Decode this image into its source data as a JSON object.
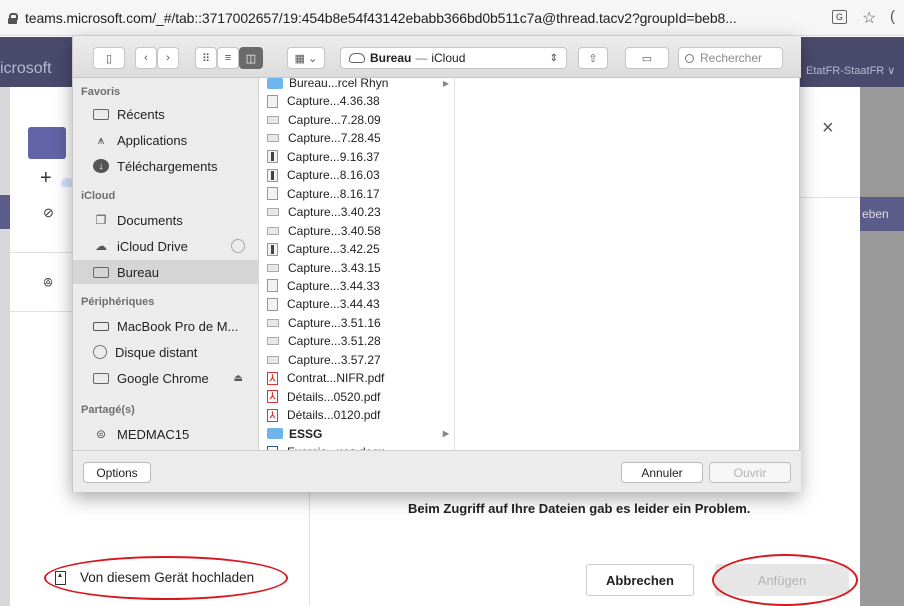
{
  "browser": {
    "url": "teams.microsoft.com/_#/tab::3717002657/19:454b8e54f43142ebabb366bd0b511c7a@thread.tacv2?groupId=beb8..."
  },
  "teams": {
    "brand": "icrosoft",
    "org": "EtatFR-StaatFR ∨",
    "right_sub": "eben"
  },
  "modal": {
    "error_message": "Beim Zugriff auf Ihre Dateien gab es leider ein Problem.",
    "upload_label": "Von diesem Gerät hochladen",
    "cancel_label": "Abbrechen",
    "attach_label": "Anfügen",
    "close_glyph": "×",
    "annotation_color": "#d7191f"
  },
  "picker": {
    "location": {
      "name": "Bureau",
      "separator": "—",
      "service": "iCloud"
    },
    "search_placeholder": "Rechercher",
    "sections": {
      "favorites": "Favoris",
      "icloud": "iCloud",
      "devices": "Périphériques",
      "shared": "Partagé(s)"
    },
    "favorites": [
      {
        "label": "Récents",
        "icon": "recents-icon"
      },
      {
        "label": "Applications",
        "icon": "applications-icon"
      },
      {
        "label": "Téléchargements",
        "icon": "downloads-icon"
      }
    ],
    "icloud": [
      {
        "label": "Documents",
        "icon": "documents-icon"
      },
      {
        "label": "iCloud Drive",
        "icon": "cloud-icon"
      },
      {
        "label": "Bureau",
        "icon": "desktop-icon",
        "selected": true
      }
    ],
    "devices": [
      {
        "label": "MacBook Pro de M...",
        "icon": "laptop-icon"
      },
      {
        "label": "Disque distant",
        "icon": "disc-icon"
      },
      {
        "label": "Google Chrome",
        "icon": "drive-icon"
      }
    ],
    "shared": [
      {
        "label": "MEDMAC15",
        "icon": "network-icon"
      }
    ],
    "files": [
      {
        "name": "Bureau...rcel Rhyn",
        "kind": "folder"
      },
      {
        "name": "Capture...4.36.38",
        "kind": "image"
      },
      {
        "name": "Capture...7.28.09",
        "kind": "image-wide"
      },
      {
        "name": "Capture...7.28.45",
        "kind": "image-wide"
      },
      {
        "name": "Capture...9.16.37",
        "kind": "image-dark"
      },
      {
        "name": "Capture...8.16.03",
        "kind": "image-dark"
      },
      {
        "name": "Capture...8.16.17",
        "kind": "image"
      },
      {
        "name": "Capture...3.40.23",
        "kind": "image-wide"
      },
      {
        "name": "Capture...3.40.58",
        "kind": "image-wide"
      },
      {
        "name": "Capture...3.42.25",
        "kind": "image-dark"
      },
      {
        "name": "Capture...3.43.15",
        "kind": "image-wide"
      },
      {
        "name": "Capture...3.44.33",
        "kind": "image"
      },
      {
        "name": "Capture...3.44.43",
        "kind": "image"
      },
      {
        "name": "Capture...3.51.16",
        "kind": "image-wide"
      },
      {
        "name": "Capture...3.51.28",
        "kind": "image-wide"
      },
      {
        "name": "Capture...3.57.27",
        "kind": "image-wide"
      },
      {
        "name": "Contrat...NIFR.pdf",
        "kind": "pdf"
      },
      {
        "name": "Détails...0520.pdf",
        "kind": "pdf"
      },
      {
        "name": "Détails...0120.pdf",
        "kind": "pdf"
      },
      {
        "name": "ESSG",
        "kind": "folder"
      },
      {
        "name": "Exercic...ues.docx",
        "kind": "doc"
      }
    ],
    "options_label": "Options",
    "cancel_label": "Annuler",
    "open_label": "Ouvrir"
  }
}
